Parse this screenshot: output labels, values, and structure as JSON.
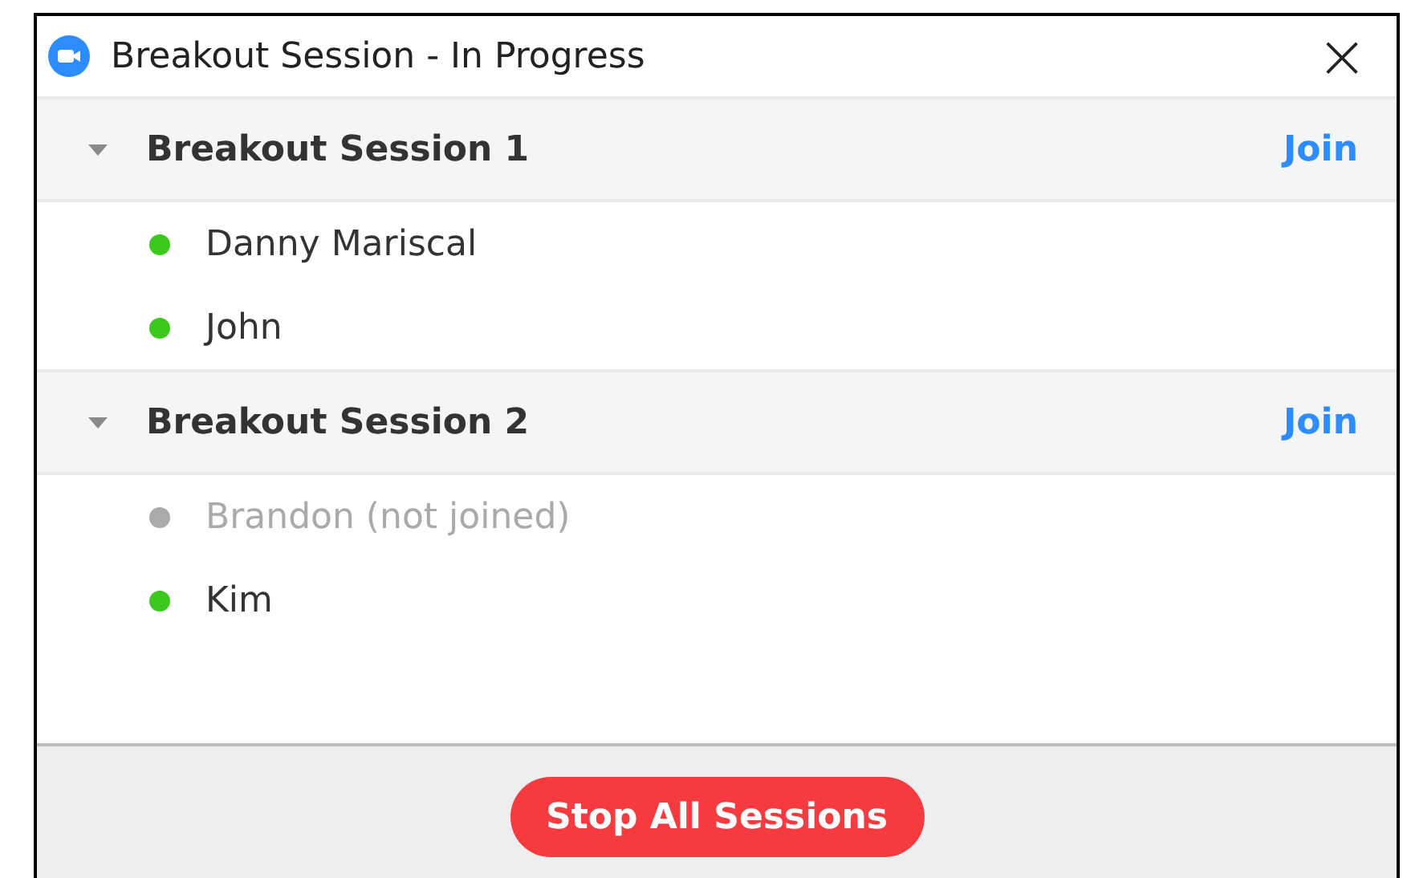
{
  "window": {
    "title": "Breakout Session - In Progress",
    "close": "×"
  },
  "sessions": [
    {
      "name": "Breakout Session 1",
      "expanded": true,
      "action": "Join",
      "participants": [
        {
          "name": "Danny Mariscal",
          "joined": true
        },
        {
          "name": "John",
          "joined": true
        }
      ]
    },
    {
      "name": "Breakout Session 2",
      "expanded": true,
      "action": "Join",
      "participants": [
        {
          "name": "Brandon (not joined)",
          "joined": false
        },
        {
          "name": "Kim",
          "joined": true
        }
      ]
    }
  ],
  "footer": {
    "button": "Stop All Sessions"
  }
}
